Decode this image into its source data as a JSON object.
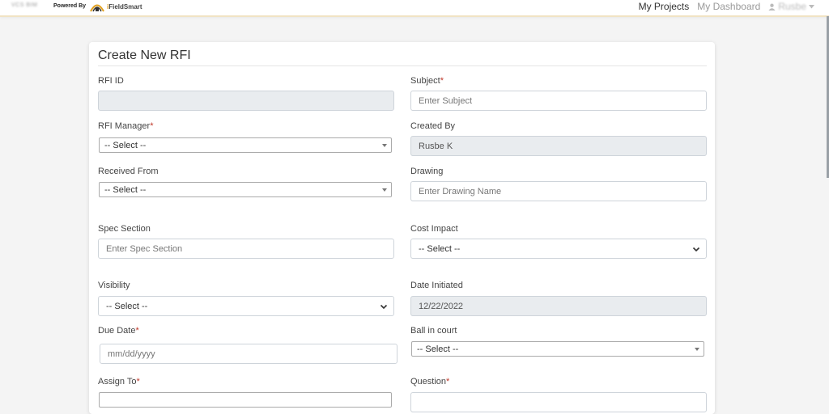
{
  "topbar": {
    "brand_left": "VCS BIM",
    "powered_by": "Powered By",
    "logo_i": "i",
    "logo_rest": "FieldSmart",
    "nav": {
      "projects": "My Projects",
      "dashboard": "My Dashboard",
      "user": "Rusbe"
    }
  },
  "form": {
    "title": "Create New RFI",
    "required_mark": "*",
    "rfi_id": {
      "label": "RFI ID",
      "value": ""
    },
    "subject": {
      "label": "Subject",
      "placeholder": "Enter Subject"
    },
    "rfi_manager": {
      "label": "RFI Manager",
      "value": "-- Select --"
    },
    "created_by": {
      "label": "Created By",
      "value": "Rusbe K"
    },
    "received_from": {
      "label": "Received From",
      "value": "-- Select --"
    },
    "drawing": {
      "label": "Drawing",
      "placeholder": "Enter Drawing Name"
    },
    "spec_section": {
      "label": "Spec Section",
      "placeholder": "Enter Spec Section"
    },
    "cost_impact": {
      "label": "Cost Impact",
      "value": "-- Select --"
    },
    "visibility": {
      "label": "Visibility",
      "value": "-- Select --"
    },
    "date_initiated": {
      "label": "Date Initiated",
      "value": "12/22/2022"
    },
    "due_date": {
      "label": "Due Date",
      "placeholder": "mm/dd/yyyy"
    },
    "ball_in_court": {
      "label": "Ball in court",
      "value": "-- Select --"
    },
    "assign_to": {
      "label": "Assign To"
    },
    "question": {
      "label": "Question"
    }
  },
  "colors": {
    "required": "#c0392b",
    "readonly_bg": "#e9ecef",
    "topbar_accent": "#f1e3c4",
    "logo_accent": "#e0a020"
  }
}
